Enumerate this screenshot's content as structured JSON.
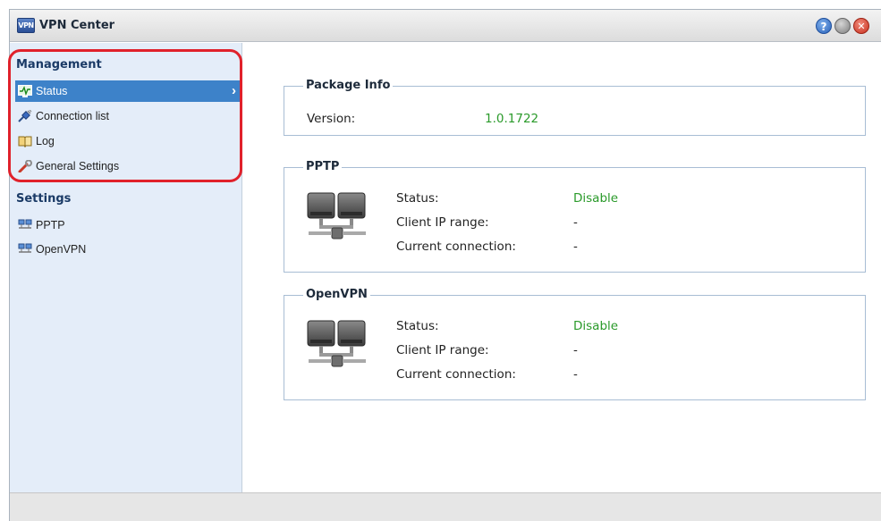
{
  "window": {
    "title": "VPN Center",
    "app_icon_text": "VPN"
  },
  "title_buttons": {
    "help": "?",
    "minimize": "",
    "close": "✕"
  },
  "sidebar": {
    "management_heading": "Management",
    "management_items": [
      {
        "label": "Status",
        "icon": "monitor-icon",
        "active": true
      },
      {
        "label": "Connection list",
        "icon": "plug-icon",
        "active": false
      },
      {
        "label": "Log",
        "icon": "book-icon",
        "active": false
      },
      {
        "label": "General Settings",
        "icon": "wrench-icon",
        "active": false
      }
    ],
    "settings_heading": "Settings",
    "settings_items": [
      {
        "label": "PPTP",
        "icon": "network-icon"
      },
      {
        "label": "OpenVPN",
        "icon": "network-icon"
      }
    ]
  },
  "package_info": {
    "legend": "Package Info",
    "version_label": "Version:",
    "version_value": "1.0.1722"
  },
  "pptp": {
    "legend": "PPTP",
    "status_label": "Status:",
    "status_value": "Disable",
    "ip_label": "Client IP range:",
    "ip_value": "-",
    "conn_label": "Current connection:",
    "conn_value": "-"
  },
  "openvpn": {
    "legend": "OpenVPN",
    "status_label": "Status:",
    "status_value": "Disable",
    "ip_label": "Client IP range:",
    "ip_value": "-",
    "conn_label": "Current connection:",
    "conn_value": "-"
  },
  "colors": {
    "active_item": "#3d82c9",
    "status_green": "#2a9a2a",
    "annotation_red": "#e0212b"
  }
}
